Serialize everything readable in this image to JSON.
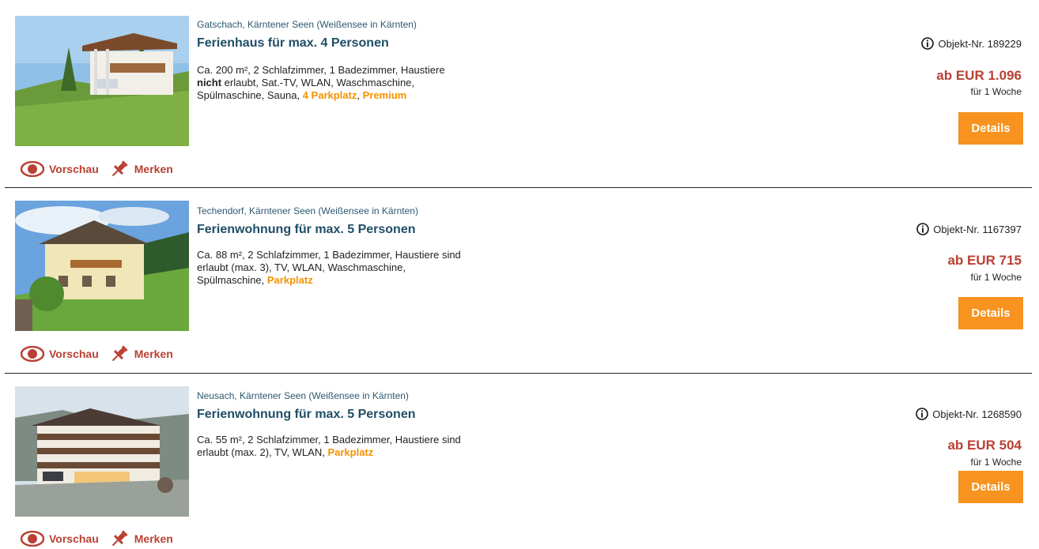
{
  "colors": {
    "accent": "#f7931e",
    "price": "#b94032",
    "title": "#1f4e66",
    "highlight": "#f39200"
  },
  "actions": {
    "preview_label": "Vorschau",
    "remember_label": "Merken",
    "preview_icon": "eye-icon",
    "remember_icon": "pin-icon"
  },
  "listings": [
    {
      "location": "Gatschach, Kärntener Seen (Weißensee in Kärnten)",
      "title": "Ferienhaus für max. 4 Personen",
      "desc_a": "Ca. 200 m², 2 Schlafzimmer, 1 Badezimmer, Haustiere",
      "desc_bold": "nicht",
      "desc_b": " erlaubt, Sat.-TV, WLAN, Waschmaschine, Spülmaschine, Sauna, ",
      "hl_1": "4 Parkplatz",
      "desc_sep": ", ",
      "hl_2": "Premium",
      "object_no": "Objekt-Nr. 189229",
      "price": "ab EUR 1.096",
      "period": "für 1 Woche",
      "details_label": "Details"
    },
    {
      "location": "Techendorf, Kärntener Seen (Weißensee in Kärnten)",
      "title": "Ferienwohnung für max. 5 Personen",
      "desc_a": "Ca. 88 m², 2 Schlafzimmer, 1 Badezimmer, Haustiere sind erlaubt (max. 3), TV, WLAN, Waschmaschine, Spülmaschine, ",
      "hl_1": "Parkplatz",
      "object_no": "Objekt-Nr. 1167397",
      "price": "ab EUR 715",
      "period": "für 1 Woche",
      "details_label": "Details"
    },
    {
      "location": "Neusach, Kärntener Seen (Weißensee in Kärnten)",
      "title": "Ferienwohnung für max. 5 Personen",
      "desc_a": "Ca. 55 m², 2 Schlafzimmer, 1 Badezimmer, Haustiere sind erlaubt (max. 2), TV, WLAN, ",
      "hl_1": "Parkplatz",
      "object_no": "Objekt-Nr. 1268590",
      "price": "ab EUR 504",
      "period": "für 1 Woche",
      "details_label": "Details"
    }
  ]
}
